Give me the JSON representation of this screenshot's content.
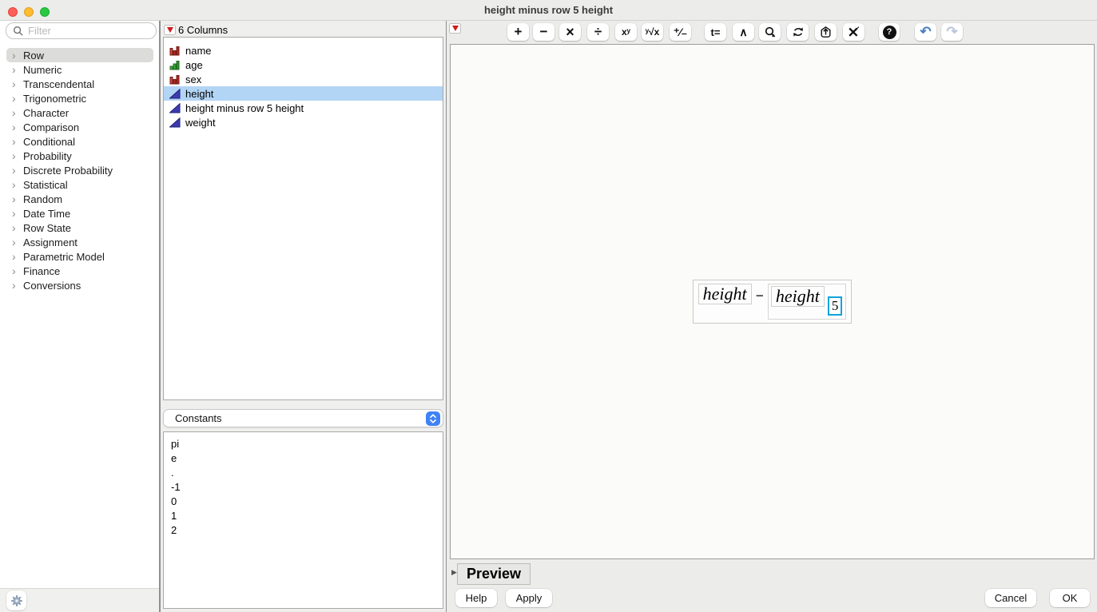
{
  "window": {
    "title": "height minus row 5 height"
  },
  "sidebar": {
    "filter_placeholder": "Filter",
    "categories": [
      {
        "label": "Row",
        "selected": true
      },
      {
        "label": "Numeric"
      },
      {
        "label": "Transcendental"
      },
      {
        "label": "Trigonometric"
      },
      {
        "label": "Character"
      },
      {
        "label": "Comparison"
      },
      {
        "label": "Conditional"
      },
      {
        "label": "Probability"
      },
      {
        "label": "Discrete Probability"
      },
      {
        "label": "Statistical"
      },
      {
        "label": "Random"
      },
      {
        "label": "Date Time"
      },
      {
        "label": "Row State"
      },
      {
        "label": "Assignment"
      },
      {
        "label": "Parametric Model"
      },
      {
        "label": "Finance"
      },
      {
        "label": "Conversions"
      }
    ]
  },
  "columns_panel": {
    "header": "6 Columns",
    "items": [
      {
        "label": "name",
        "type": "nominal"
      },
      {
        "label": "age",
        "type": "ordinal"
      },
      {
        "label": "sex",
        "type": "nominal"
      },
      {
        "label": "height",
        "type": "continuous",
        "selected": true
      },
      {
        "label": "height minus row 5 height",
        "type": "continuous"
      },
      {
        "label": "weight",
        "type": "continuous"
      }
    ]
  },
  "functions_panel": {
    "group_selector": "Constants",
    "items": [
      "pi",
      "e",
      ".",
      "-1",
      "0",
      "1",
      "2"
    ]
  },
  "toolbar": {
    "buttons": [
      {
        "name": "add",
        "glyph": "+"
      },
      {
        "name": "subtract",
        "glyph": "−"
      },
      {
        "name": "multiply",
        "glyph": "×"
      },
      {
        "name": "divide",
        "glyph": "÷"
      },
      {
        "name": "power",
        "glyph": "xʸ"
      },
      {
        "name": "root",
        "glyph": "ʸ√x"
      },
      {
        "name": "switch-sign",
        "glyph": "⁺⁄₋"
      },
      {
        "name": "local-variable",
        "glyph": "t="
      },
      {
        "name": "peel-expression",
        "glyph": "∧"
      },
      {
        "name": "rotate-term",
        "icon": "rotate-q-icon"
      },
      {
        "name": "swap-terms",
        "icon": "circular-arrows-icon"
      },
      {
        "name": "boxing",
        "icon": "up-arrow-badge-icon"
      },
      {
        "name": "delete-expression",
        "icon": "delete-x-icon"
      },
      {
        "name": "help",
        "glyph": "?"
      },
      {
        "name": "undo",
        "glyph": "↶"
      },
      {
        "name": "redo",
        "glyph": "↷"
      }
    ]
  },
  "formula": {
    "left_operand": "height",
    "operator": "−",
    "right_operand": "height",
    "row_subscript": "5"
  },
  "preview": {
    "label": "Preview"
  },
  "actions": {
    "help": "Help",
    "apply": "Apply",
    "cancel": "Cancel",
    "ok": "OK"
  },
  "colors": {
    "selection_blue": "#b3d5f5",
    "term_highlight_border": "#12a3dc",
    "continuous_icon": "#3c3cae",
    "nominal_icon": "#b02a22",
    "ordinal_icon": "#3fa73f",
    "red_triangle": "#cf1b1b",
    "undo_enabled": "#4a7fc1",
    "redo_disabled": "#b9c6d9",
    "stepper_blue": "#3f82f7"
  }
}
